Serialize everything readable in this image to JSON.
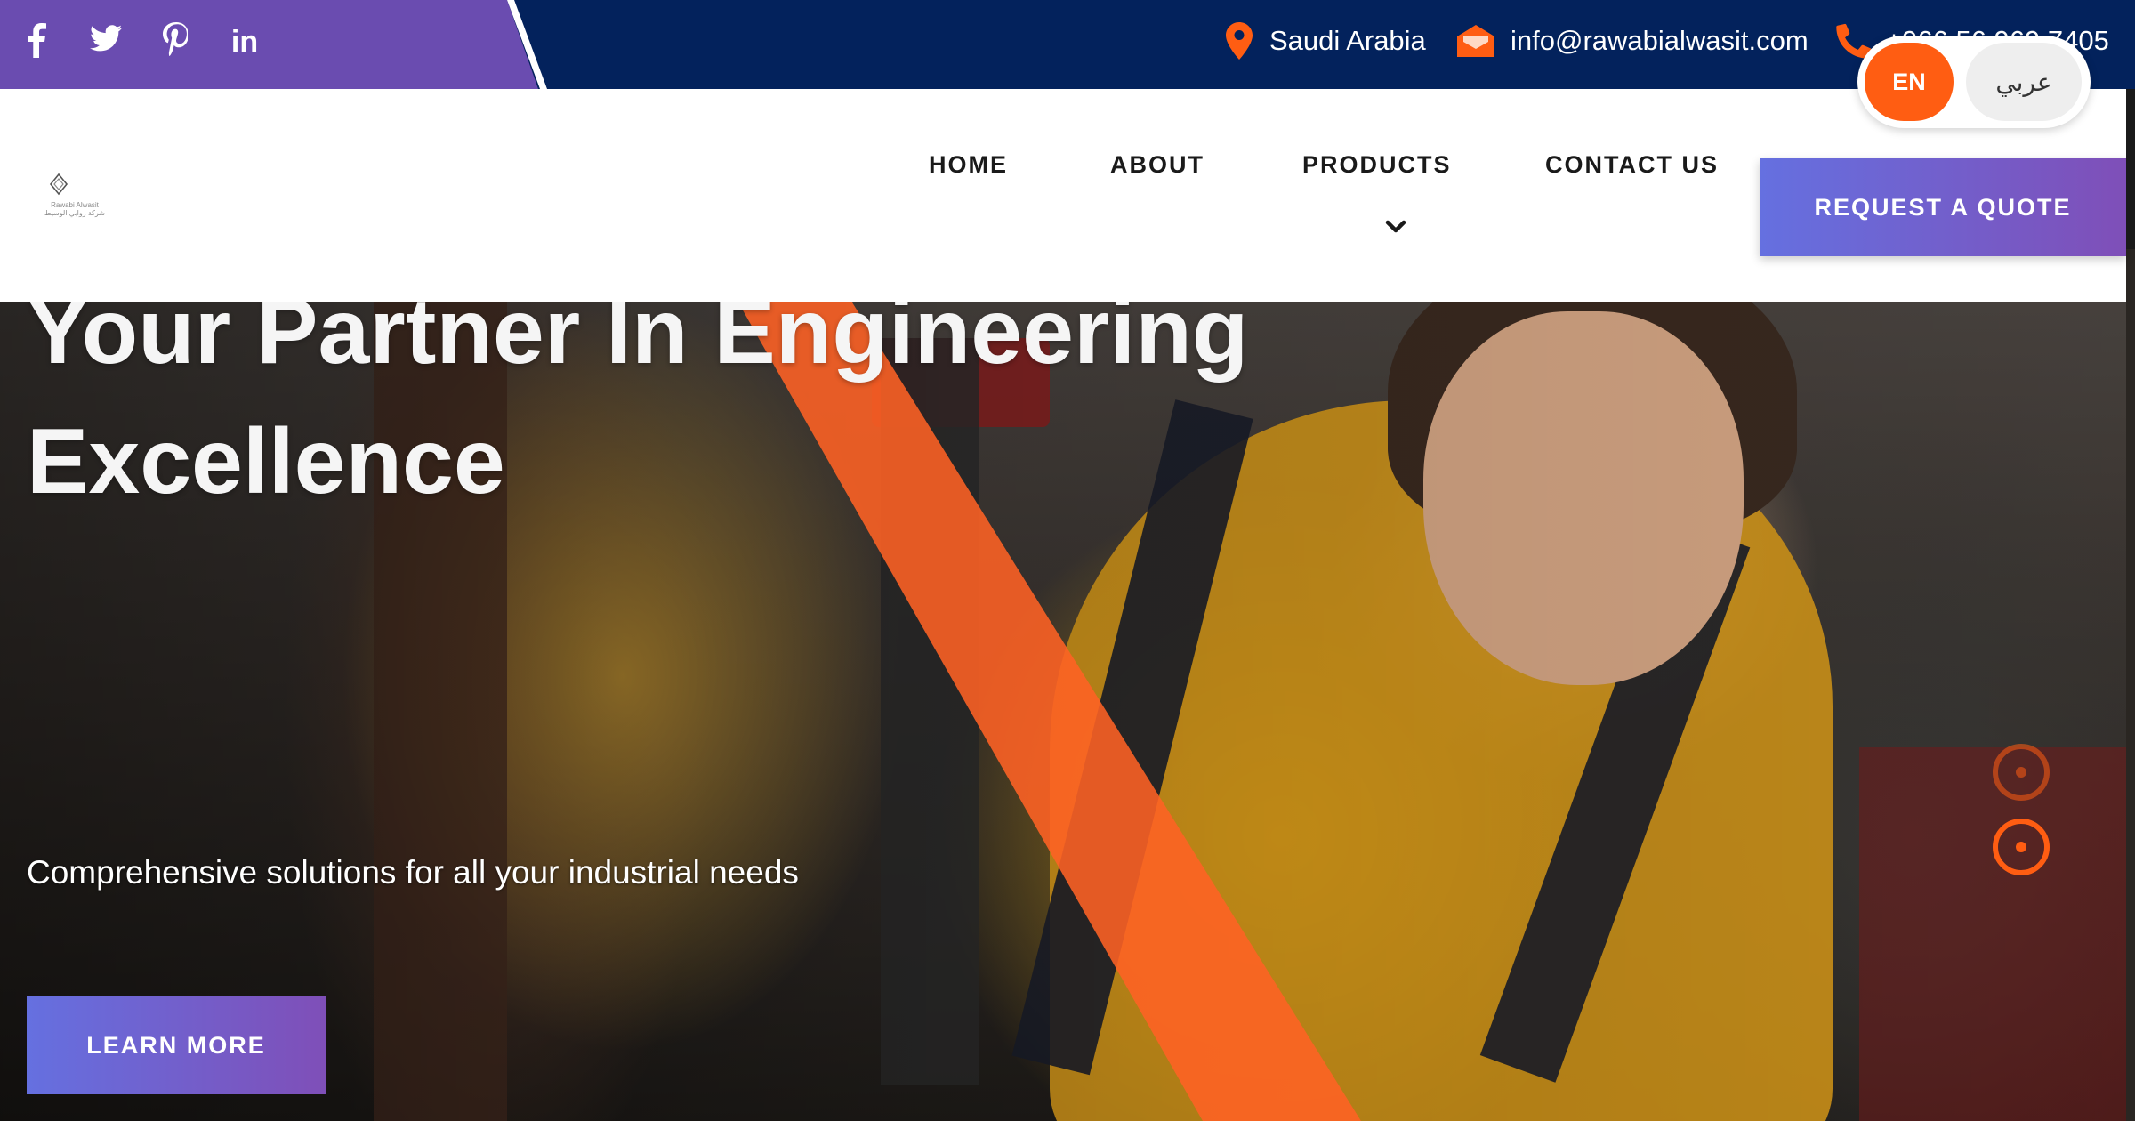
{
  "topbar": {
    "social": [
      {
        "icon": "facebook-icon",
        "glyph": "f"
      },
      {
        "icon": "twitter-icon",
        "glyph": "t"
      },
      {
        "icon": "pinterest-icon",
        "glyph": "p"
      },
      {
        "icon": "linkedin-icon",
        "glyph": "in"
      }
    ],
    "location": "Saudi Arabia",
    "email": "info@rawabialwasit.com",
    "phone": "+966 56 969 7405"
  },
  "language": {
    "en": "EN",
    "ar": "عربي"
  },
  "logo": {
    "name": "Rawabi Alwasit",
    "arabic": "شركة روابي الوسيط"
  },
  "nav": {
    "home": "HOME",
    "about": "ABOUT",
    "products": "PRODUCTS",
    "contact": "CONTACT US",
    "quote": "REQUEST A QUOTE"
  },
  "hero": {
    "title_line1": "Your Partner In Engineering",
    "title_line2": "Excellence",
    "subtitle": "Comprehensive solutions for all your industrial needs",
    "cta": "LEARN MORE",
    "slides": 2,
    "active_slide": 2
  },
  "colors": {
    "topbar": "#03225c",
    "social_wedge": "#6a4cb0",
    "accent": "#ff5d12",
    "button_gradient_start": "#6570e0",
    "button_gradient_end": "#7f4fb8"
  }
}
